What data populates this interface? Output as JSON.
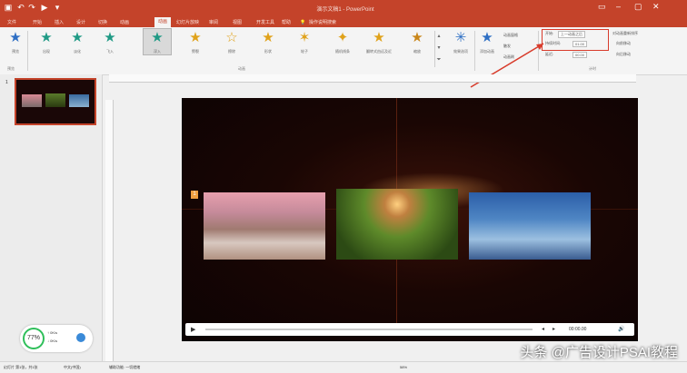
{
  "title_bar": {
    "title": "演示文稿1 - PowerPoint",
    "qa_icons": [
      "save-icon",
      "undo-icon",
      "redo-icon",
      "start-icon"
    ]
  },
  "tabs": [
    "文件",
    "开始",
    "插入",
    "设计",
    "切换",
    "动画",
    "幻灯片放映",
    "审阅",
    "视图",
    "开发工具",
    "帮助",
    "操作说明搜索"
  ],
  "active_tab_index": 5,
  "ribbon": {
    "preview_label": "预览",
    "effects": [
      "出现",
      "淡化",
      "飞入",
      "浮入",
      "劈裂",
      "擦除",
      "形状",
      "轮子",
      "随机线条",
      "翻转式由远及近",
      "缩放",
      "旋转"
    ],
    "selected_effect": "浮入",
    "group_preview": "预览",
    "group_animation": "动画",
    "group_timing": "计时",
    "effect_options": "效果选项",
    "add_animation": "添加动画",
    "animation_pane": "动画窗格",
    "trigger": "触发",
    "animation_painter": "动画刷",
    "start_label": "开始:",
    "start_value": "上一动画之后",
    "duration_label": "持续时间:",
    "duration_value": "01.00",
    "delay_label": "延迟:",
    "delay_value": "00.00",
    "reorder_title": "对动画重新排序",
    "move_earlier": "向前移动",
    "move_later": "向后移动"
  },
  "slide_panel": {
    "slide_number": "1"
  },
  "slide": {
    "animation_marker": "1",
    "timecode": "00:00.00"
  },
  "status": {
    "slide_info": "幻灯片 第1张，共1张",
    "language": "中文(中国)",
    "accessibility": "辅助功能: 一切就绪",
    "zoom": "58%"
  },
  "badge": {
    "percent": "77%",
    "line1": "↑ 0K/s",
    "line2": "↓ 0K/s"
  },
  "watermark": "头条 @广告设计PSAI教程",
  "colors": {
    "accent": "#c4432a",
    "slide_bg": "#140505",
    "annotation_red": "#d83b2b",
    "badge_ring": "#2fbf5a"
  }
}
